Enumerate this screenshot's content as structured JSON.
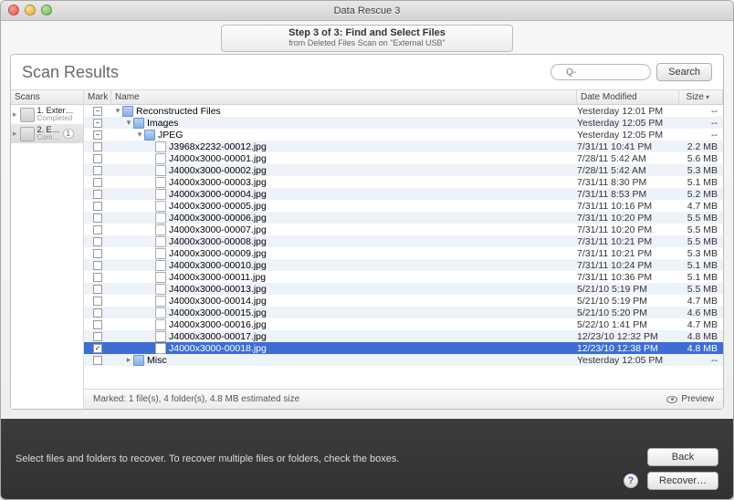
{
  "window": {
    "title": "Data Rescue 3"
  },
  "step": {
    "line1": "Step 3 of 3: Find and Select Files",
    "line2": "from Deleted Files Scan on \"External USB\""
  },
  "header": {
    "title": "Scan Results",
    "search_placeholder": "Q-",
    "search_button": "Search"
  },
  "scans": {
    "header": "Scans",
    "items": [
      {
        "name": "1. Exter…",
        "status": "Completed",
        "selected": false,
        "badge": ""
      },
      {
        "name": "2. E…",
        "status": "Com…",
        "selected": true,
        "badge": "1"
      }
    ]
  },
  "columns": {
    "mark": "Mark",
    "name": "Name",
    "date": "Date Modified",
    "size": "Size"
  },
  "rows": [
    {
      "indent": 0,
      "kind": "folder",
      "expandable": true,
      "expanded": true,
      "mark": "mixed",
      "name": "Reconstructed Files",
      "date": "Yesterday 12:01 PM",
      "size": "--",
      "selected": false
    },
    {
      "indent": 1,
      "kind": "folder",
      "expandable": true,
      "expanded": true,
      "mark": "mixed",
      "name": "Images",
      "date": "Yesterday 12:05 PM",
      "size": "--",
      "selected": false
    },
    {
      "indent": 2,
      "kind": "folder",
      "expandable": true,
      "expanded": true,
      "mark": "mixed",
      "name": "JPEG",
      "date": "Yesterday 12:05 PM",
      "size": "--",
      "selected": false
    },
    {
      "indent": 3,
      "kind": "file",
      "expandable": false,
      "mark": "off",
      "name": "J3968x2232-00012.jpg",
      "date": "7/31/11 10:41 PM",
      "size": "2.2 MB",
      "selected": false
    },
    {
      "indent": 3,
      "kind": "file",
      "expandable": false,
      "mark": "off",
      "name": "J4000x3000-00001.jpg",
      "date": "7/28/11 5:42 AM",
      "size": "5.6 MB",
      "selected": false
    },
    {
      "indent": 3,
      "kind": "file",
      "expandable": false,
      "mark": "off",
      "name": "J4000x3000-00002.jpg",
      "date": "7/28/11 5:42 AM",
      "size": "5.3 MB",
      "selected": false
    },
    {
      "indent": 3,
      "kind": "file",
      "expandable": false,
      "mark": "off",
      "name": "J4000x3000-00003.jpg",
      "date": "7/31/11 8:30 PM",
      "size": "5.1 MB",
      "selected": false
    },
    {
      "indent": 3,
      "kind": "file",
      "expandable": false,
      "mark": "off",
      "name": "J4000x3000-00004.jpg",
      "date": "7/31/11 8:53 PM",
      "size": "5.2 MB",
      "selected": false
    },
    {
      "indent": 3,
      "kind": "file",
      "expandable": false,
      "mark": "off",
      "name": "J4000x3000-00005.jpg",
      "date": "7/31/11 10:16 PM",
      "size": "4.7 MB",
      "selected": false
    },
    {
      "indent": 3,
      "kind": "file",
      "expandable": false,
      "mark": "off",
      "name": "J4000x3000-00006.jpg",
      "date": "7/31/11 10:20 PM",
      "size": "5.5 MB",
      "selected": false
    },
    {
      "indent": 3,
      "kind": "file",
      "expandable": false,
      "mark": "off",
      "name": "J4000x3000-00007.jpg",
      "date": "7/31/11 10:20 PM",
      "size": "5.5 MB",
      "selected": false
    },
    {
      "indent": 3,
      "kind": "file",
      "expandable": false,
      "mark": "off",
      "name": "J4000x3000-00008.jpg",
      "date": "7/31/11 10:21 PM",
      "size": "5.5 MB",
      "selected": false
    },
    {
      "indent": 3,
      "kind": "file",
      "expandable": false,
      "mark": "off",
      "name": "J4000x3000-00009.jpg",
      "date": "7/31/11 10:21 PM",
      "size": "5.3 MB",
      "selected": false
    },
    {
      "indent": 3,
      "kind": "file",
      "expandable": false,
      "mark": "off",
      "name": "J4000x3000-00010.jpg",
      "date": "7/31/11 10:24 PM",
      "size": "5.1 MB",
      "selected": false
    },
    {
      "indent": 3,
      "kind": "file",
      "expandable": false,
      "mark": "off",
      "name": "J4000x3000-00011.jpg",
      "date": "7/31/11 10:36 PM",
      "size": "5.1 MB",
      "selected": false
    },
    {
      "indent": 3,
      "kind": "file",
      "expandable": false,
      "mark": "off",
      "name": "J4000x3000-00013.jpg",
      "date": "5/21/10 5:19 PM",
      "size": "5.5 MB",
      "selected": false
    },
    {
      "indent": 3,
      "kind": "file",
      "expandable": false,
      "mark": "off",
      "name": "J4000x3000-00014.jpg",
      "date": "5/21/10 5:19 PM",
      "size": "4.7 MB",
      "selected": false
    },
    {
      "indent": 3,
      "kind": "file",
      "expandable": false,
      "mark": "off",
      "name": "J4000x3000-00015.jpg",
      "date": "5/21/10 5:20 PM",
      "size": "4.6 MB",
      "selected": false
    },
    {
      "indent": 3,
      "kind": "file",
      "expandable": false,
      "mark": "off",
      "name": "J4000x3000-00016.jpg",
      "date": "5/22/10 1:41 PM",
      "size": "4.7 MB",
      "selected": false
    },
    {
      "indent": 3,
      "kind": "file",
      "expandable": false,
      "mark": "off",
      "name": "J4000x3000-00017.jpg",
      "date": "12/23/10 12:32 PM",
      "size": "4.8 MB",
      "selected": false
    },
    {
      "indent": 3,
      "kind": "file",
      "expandable": false,
      "mark": "on",
      "name": "J4000x3000-00018.jpg",
      "date": "12/23/10 12:38 PM",
      "size": "4.8 MB",
      "selected": true
    },
    {
      "indent": 1,
      "kind": "folder",
      "expandable": true,
      "expanded": false,
      "mark": "off",
      "name": "Misc",
      "date": "Yesterday 12:05 PM",
      "size": "--",
      "selected": false
    }
  ],
  "footer": {
    "status": "Marked: 1 file(s), 4 folder(s), 4.8 MB estimated size",
    "preview": "Preview"
  },
  "bottom": {
    "hint": "Select files and folders to recover. To recover multiple files or folders, check the boxes.",
    "back": "Back",
    "recover": "Recover…"
  }
}
